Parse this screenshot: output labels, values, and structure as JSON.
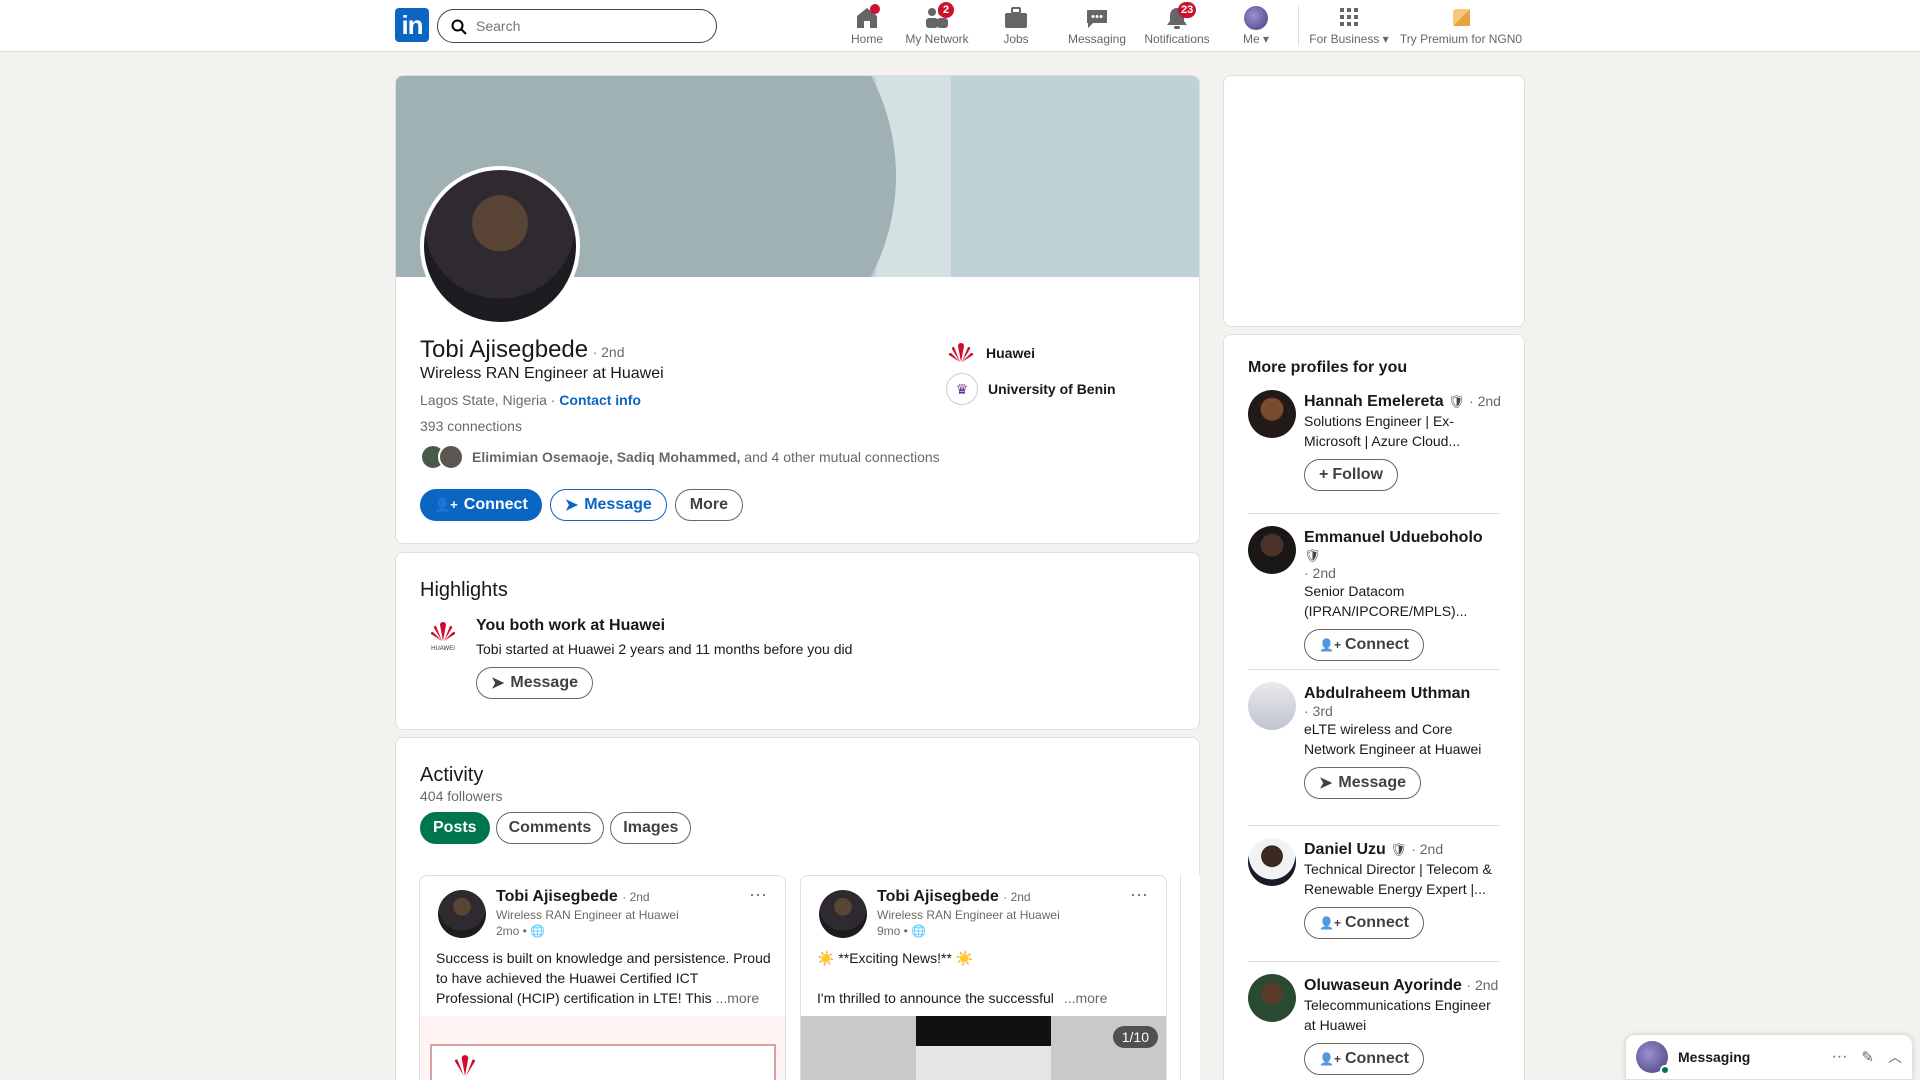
{
  "nav": {
    "search_placeholder": "Search",
    "home": "Home",
    "network": "My Network",
    "network_badge": "2",
    "jobs": "Jobs",
    "messaging": "Messaging",
    "notifications": "Notifications",
    "notifications_badge": "23",
    "me": "Me",
    "business": "For Business",
    "premium": "Try Premium for NGN0"
  },
  "profile": {
    "name": "Tobi Ajisegbede",
    "degree": "· 2nd",
    "headline": "Wireless RAN Engineer at Huawei",
    "location": "Lagos State, Nigeria ·",
    "contact": "Contact info",
    "connections": "393 connections",
    "mutual_names": "Elimimian Osemaoje, Sadiq Mohammed,",
    "mutual_rest": " and 4 other mutual connections",
    "company": "Huawei",
    "school": "University of Benin",
    "connect": "Connect",
    "message": "Message",
    "more": "More"
  },
  "highlights": {
    "title": "Highlights",
    "item_title": "You both work at Huawei",
    "item_text": "Tobi started at Huawei 2 years and 11 months before you did",
    "message": "Message"
  },
  "activity": {
    "title": "Activity",
    "followers": "404 followers",
    "tabs": [
      "Posts",
      "Comments",
      "Images"
    ],
    "posts": [
      {
        "author": "Tobi Ajisegbede",
        "degree": "· 2nd",
        "headline": "Wireless RAN Engineer at Huawei",
        "time": "2mo •",
        "text": "Success is built on knowledge and persistence. Proud to have achieved the Huawei Certified ICT Professional (HCIP) certification in LTE! This",
        "more": "...more"
      },
      {
        "author": "Tobi Ajisegbede",
        "degree": "· 2nd",
        "headline": "Wireless RAN Engineer at Huawei",
        "time": "9mo •",
        "text_line1": "☀️ **Exciting News!** ☀️",
        "text_line2": "I'm thrilled to announce the successful",
        "more": "...more",
        "counter": "1/10"
      }
    ]
  },
  "sidebar": {
    "title": "More profiles for you",
    "profiles": [
      {
        "name": "Hannah Emelereta",
        "degree": "· 2nd",
        "headline": "Solutions Engineer | Ex-Microsoft | Azure Cloud...",
        "action": "Follow"
      },
      {
        "name": "Emmanuel Udueboholo",
        "degree": "· 2nd",
        "headline": "Senior Datacom (IPRAN/IPCORE/MPLS)...",
        "action": "Connect"
      },
      {
        "name": "Abdulraheem Uthman",
        "degree": "· 3rd",
        "headline": "eLTE wireless and Core Network Engineer at Huawei",
        "action": "Message"
      },
      {
        "name": "Daniel Uzu",
        "degree": "· 2nd",
        "headline": "Technical Director | Telecom & Renewable Energy Expert |...",
        "action": "Connect"
      },
      {
        "name": "Oluwaseun Ayorinde",
        "degree": "· 2nd",
        "headline": "Telecommunications Engineer at Huawei",
        "action": "Connect"
      }
    ]
  },
  "messaging": {
    "label": "Messaging"
  },
  "colors": {
    "brand": "#0a66c2",
    "active_tab": "#01754f",
    "badge": "#cb112d"
  }
}
